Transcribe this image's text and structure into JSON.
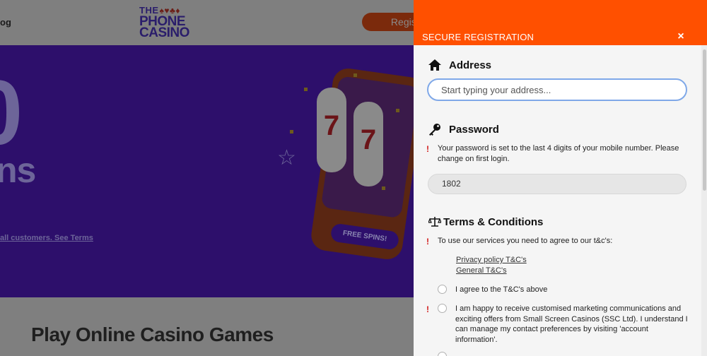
{
  "background": {
    "nav_fragment": "og",
    "logo": {
      "line1": "THE",
      "line2": "PHONE",
      "line3": "CASINO",
      "suits": "♠♥♣♦"
    },
    "register_label": "Register",
    "hero": {
      "big_digit": "0",
      "line_fragment": "ns",
      "terms_fragment": "all customers. See Terms",
      "free_spins": "FREE SPINS!",
      "reel_symbol": "7"
    },
    "heading": "Play Online Casino Games"
  },
  "panel": {
    "title": "SECURE REGISTRATION",
    "close_symbol": "×",
    "address": {
      "heading": "Address",
      "placeholder": "Start typing your address..."
    },
    "password": {
      "heading": "Password",
      "warning_mark": "!",
      "note": "Your password is set to the last 4 digits of your mobile number. Please change on first login.",
      "value": "1802"
    },
    "terms": {
      "heading": "Terms & Conditions",
      "intro": "To use our services you need to agree to our t&c's:",
      "privacy_link": "Privacy policy T&C's",
      "general_link": "General T&C's",
      "agree_label": "I agree to the T&C's above",
      "marketing_label": "I am happy to receive customised marketing communications and exciting offers from Small Screen Casinos (SSC Ltd). I understand I can manage my contact preferences by visiting 'account information'."
    }
  },
  "colors": {
    "panel_header": "#ff5000",
    "warning": "#d21a1a",
    "input_focus_border": "#7fa8e8",
    "hero_bg_dimmed": "#2d0f6b"
  },
  "icons": {
    "address": "home-icon",
    "password": "key-icon",
    "terms": "scales-icon",
    "close": "close-icon"
  }
}
